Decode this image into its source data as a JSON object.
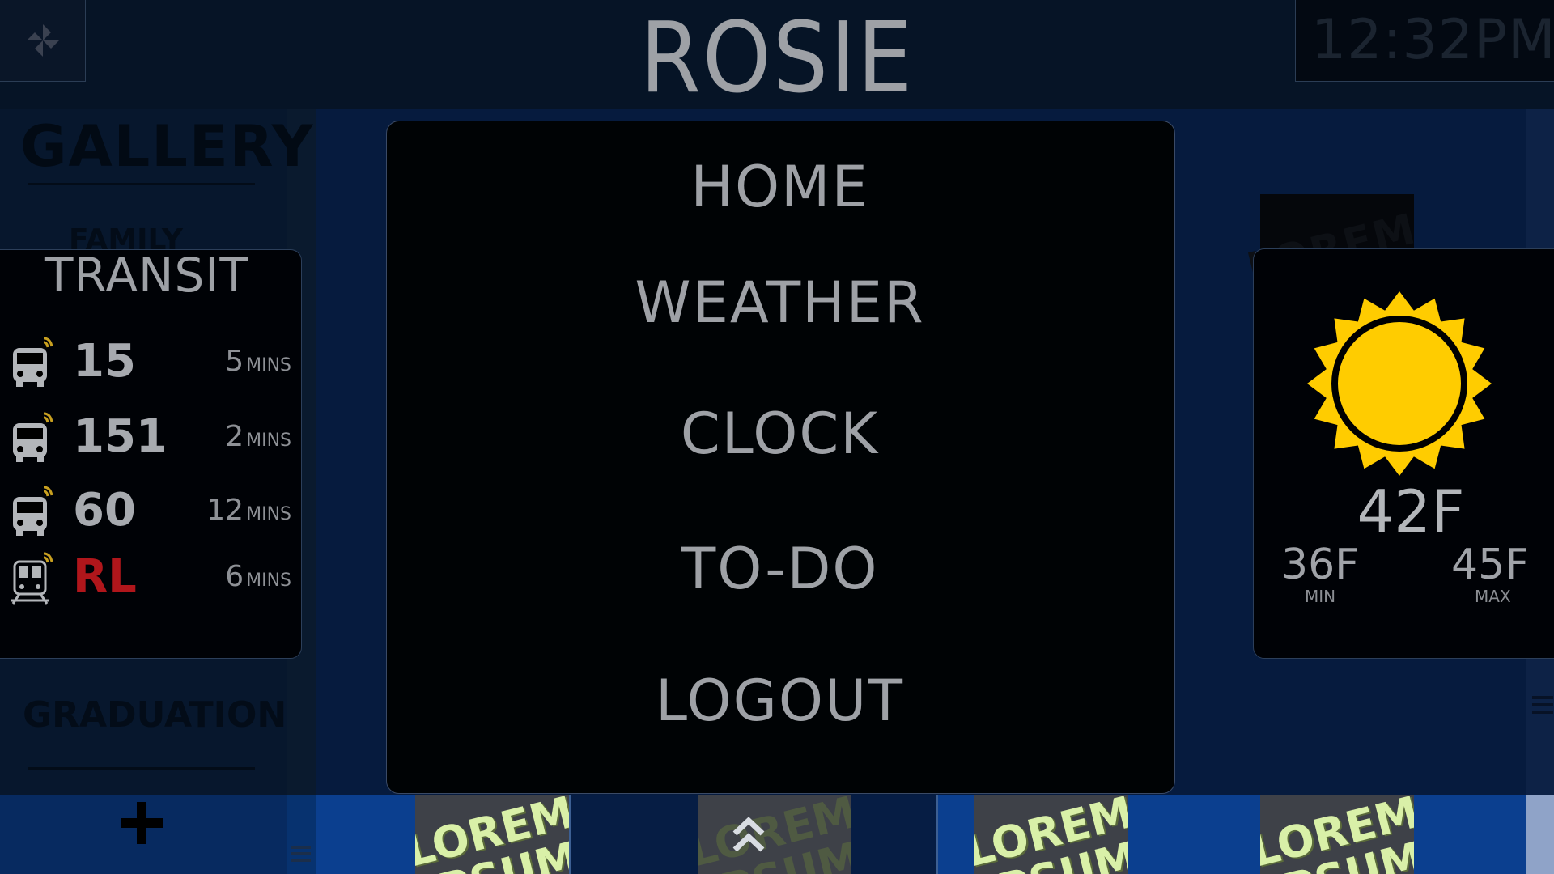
{
  "header": {
    "title": "ROSIE",
    "time": "12:32PM",
    "logo_icon": "pinwheel-icon"
  },
  "gallery": {
    "title": "GALLERY",
    "section_family": "FAMILY",
    "section_graduation": "GRADUATION",
    "thumb_text": "LOREM IPSUM"
  },
  "transit": {
    "title": "TRANSIT",
    "routes": [
      {
        "number": "15",
        "time": "5",
        "unit": "MINS",
        "icon": "bus-icon",
        "color": "#a7aaaf"
      },
      {
        "number": "151",
        "time": "2",
        "unit": "MINS",
        "icon": "bus-icon",
        "color": "#a7aaaf"
      },
      {
        "number": "60",
        "time": "12",
        "unit": "MINS",
        "icon": "bus-icon",
        "color": "#a7aaaf"
      },
      {
        "number": "RL",
        "time": "6",
        "unit": "MINS",
        "icon": "train-icon",
        "color": "#b0161b"
      }
    ]
  },
  "menu": {
    "items": [
      "HOME",
      "WEATHER",
      "CLOCK",
      "TO-DO",
      "LOGOUT"
    ]
  },
  "weather": {
    "icon": "sun-icon",
    "current": "42F",
    "min": "36F",
    "min_label": "MIN",
    "max": "45F",
    "max_label": "MAX",
    "sun_color": "#ffcc00"
  },
  "bottom_bar": {
    "add_icon": "plus-icon",
    "collapse_icon": "chevron-up-icon",
    "thumb_text": "LOREM IPSUM"
  }
}
